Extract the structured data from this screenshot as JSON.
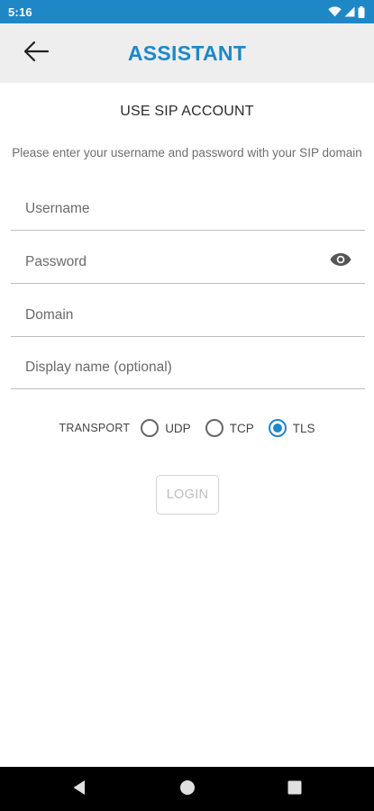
{
  "status_bar": {
    "time": "5:16",
    "icons": [
      "wifi-icon",
      "signal-icon",
      "battery-icon"
    ],
    "background_color": "#1e88c7"
  },
  "app_bar": {
    "title": "ASSISTANT",
    "back_icon": "arrow-left-icon",
    "title_color": "#1e88c7"
  },
  "page": {
    "heading": "USE SIP ACCOUNT",
    "instructions": "Please enter your username and password with your SIP domain"
  },
  "form": {
    "username": {
      "placeholder": "Username",
      "value": ""
    },
    "password": {
      "placeholder": "Password",
      "value": "",
      "toggle_icon": "eye-icon"
    },
    "domain": {
      "placeholder": "Domain",
      "value": ""
    },
    "display_name": {
      "placeholder": "Display name (optional)",
      "value": ""
    }
  },
  "transport": {
    "label": "TRANSPORT",
    "options": [
      "UDP",
      "TCP",
      "TLS"
    ],
    "selected": "TLS"
  },
  "login_button": {
    "label": "LOGIN",
    "enabled": false
  },
  "nav_bar": {
    "icons": [
      "back-triangle-icon",
      "home-circle-icon",
      "recents-square-icon"
    ]
  }
}
